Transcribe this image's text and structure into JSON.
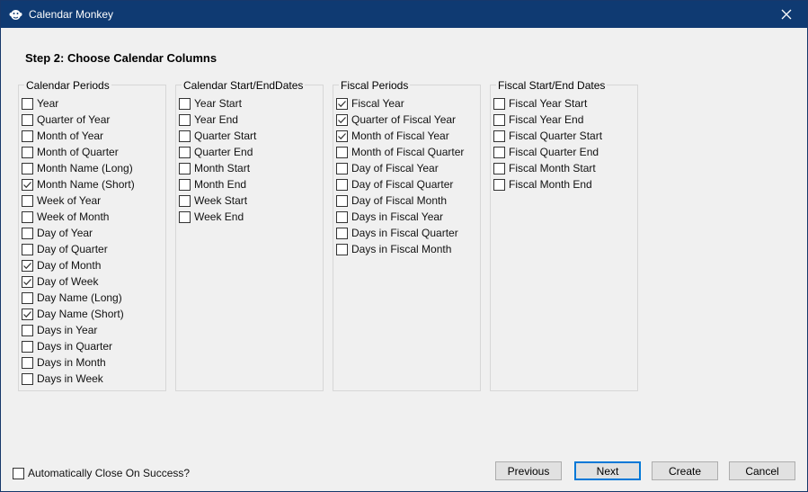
{
  "window": {
    "title": "Calendar Monkey",
    "app_icon": "monkey-icon",
    "close_icon": "close-icon"
  },
  "step_title": "Step 2:  Choose Calendar Columns",
  "groups": [
    {
      "label": "Calendar Periods",
      "items": [
        {
          "label": "Year",
          "checked": false
        },
        {
          "label": "Quarter of Year",
          "checked": false
        },
        {
          "label": "Month of Year",
          "checked": false
        },
        {
          "label": "Month of Quarter",
          "checked": false
        },
        {
          "label": "Month Name (Long)",
          "checked": false
        },
        {
          "label": "Month Name (Short)",
          "checked": true
        },
        {
          "label": "Week of Year",
          "checked": false
        },
        {
          "label": "Week of Month",
          "checked": false
        },
        {
          "label": "Day of Year",
          "checked": false
        },
        {
          "label": "Day of Quarter",
          "checked": false
        },
        {
          "label": "Day of Month",
          "checked": true
        },
        {
          "label": "Day of Week",
          "checked": true
        },
        {
          "label": "Day Name (Long)",
          "checked": false
        },
        {
          "label": "Day Name (Short)",
          "checked": true
        },
        {
          "label": "Days in Year",
          "checked": false
        },
        {
          "label": "Days in Quarter",
          "checked": false
        },
        {
          "label": "Days in Month",
          "checked": false
        },
        {
          "label": "Days in Week",
          "checked": false
        }
      ]
    },
    {
      "label": "Calendar Start/EndDates",
      "items": [
        {
          "label": "Year Start",
          "checked": false
        },
        {
          "label": "Year End",
          "checked": false
        },
        {
          "label": "Quarter Start",
          "checked": false
        },
        {
          "label": "Quarter End",
          "checked": false
        },
        {
          "label": "Month Start",
          "checked": false
        },
        {
          "label": "Month End",
          "checked": false
        },
        {
          "label": "Week Start",
          "checked": false
        },
        {
          "label": "Week End",
          "checked": false
        }
      ]
    },
    {
      "label": "Fiscal Periods",
      "items": [
        {
          "label": "Fiscal Year",
          "checked": true
        },
        {
          "label": "Quarter of Fiscal Year",
          "checked": true
        },
        {
          "label": "Month of Fiscal Year",
          "checked": true
        },
        {
          "label": "Month of Fiscal Quarter",
          "checked": false
        },
        {
          "label": "Day of Fiscal Year",
          "checked": false
        },
        {
          "label": "Day of Fiscal Quarter",
          "checked": false
        },
        {
          "label": "Day of Fiscal Month",
          "checked": false
        },
        {
          "label": "Days in Fiscal Year",
          "checked": false
        },
        {
          "label": "Days in Fiscal Quarter",
          "checked": false
        },
        {
          "label": "Days in Fiscal Month",
          "checked": false
        }
      ]
    },
    {
      "label": "Fiscal Start/End Dates",
      "items": [
        {
          "label": "Fiscal Year Start",
          "checked": false
        },
        {
          "label": "Fiscal Year End",
          "checked": false
        },
        {
          "label": "Fiscal Quarter Start",
          "checked": false
        },
        {
          "label": "Fiscal Quarter End",
          "checked": false
        },
        {
          "label": "Fiscal Month Start",
          "checked": false
        },
        {
          "label": "Fiscal Month End",
          "checked": false
        }
      ]
    }
  ],
  "auto_close": {
    "label": "Automatically Close On Success?",
    "checked": false
  },
  "buttons": {
    "previous": "Previous",
    "next": "Next",
    "create": "Create",
    "cancel": "Cancel"
  },
  "colors": {
    "titlebar": "#0f3a72",
    "default_button_border": "#0078d7"
  }
}
